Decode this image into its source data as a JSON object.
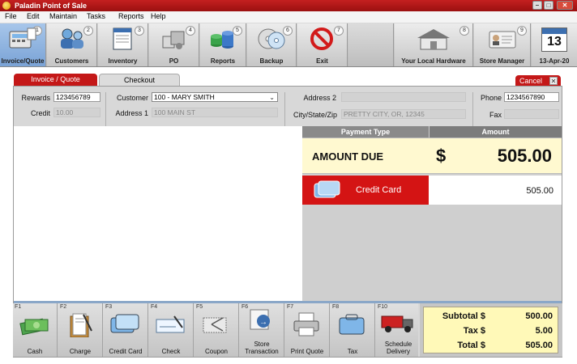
{
  "app": {
    "title": "Paladin Point of Sale"
  },
  "window": {
    "minimize": "–",
    "maximize": "□",
    "close": "✕"
  },
  "menu": [
    "File",
    "Edit",
    "Maintain",
    "Tasks",
    "Reports",
    "Help"
  ],
  "toolbar": {
    "items": [
      {
        "label": "Invoice/Quote",
        "key": "1",
        "icon": "invoice-icon"
      },
      {
        "label": "Customers",
        "key": "2",
        "icon": "customers-icon"
      },
      {
        "label": "Inventory",
        "key": "3",
        "icon": "inventory-icon"
      },
      {
        "label": "PO",
        "key": "4",
        "icon": "po-icon"
      },
      {
        "label": "Reports",
        "key": "5",
        "icon": "reports-icon"
      },
      {
        "label": "Backup",
        "key": "6",
        "icon": "backup-icon"
      },
      {
        "label": "Exit",
        "key": "7",
        "icon": "exit-icon"
      }
    ],
    "right_items": [
      {
        "label": "Your Local Hardware",
        "key": "8",
        "icon": "store-icon"
      },
      {
        "label": "Store Manager",
        "key": "9",
        "icon": "manager-icon"
      }
    ],
    "calendar": {
      "day": "13",
      "date": "13-Apr-20"
    }
  },
  "tabs": {
    "invoice": "Invoice / Quote",
    "checkout": "Checkout"
  },
  "cancel": {
    "label": "Cancel",
    "x": "✕"
  },
  "customer_form": {
    "rewards_label": "Rewards",
    "rewards_value": "123456789",
    "credit_label": "Credit",
    "credit_value": "10.00",
    "customer_label": "Customer",
    "customer_value": "100 - MARY SMITH",
    "address1_label": "Address 1",
    "address1_value": "100 MAIN ST",
    "address2_label": "Address 2",
    "address2_value": "",
    "cityzip_label": "City/State/Zip",
    "cityzip_value": "PRETTY CITY, OR, 12345",
    "phone_label": "Phone",
    "phone_value": "1234567890",
    "fax_label": "Fax",
    "fax_value": ""
  },
  "payment": {
    "type_header": "Payment Type",
    "amount_header": "Amount",
    "amount_due_label": "AMOUNT DUE",
    "currency": "$",
    "amount_due_value": "505.00",
    "method_label": "Credit Card",
    "method_value": "505.00"
  },
  "functions": [
    {
      "key": "F1",
      "label": "Cash"
    },
    {
      "key": "F2",
      "label": "Charge"
    },
    {
      "key": "F3",
      "label": "Credit Card"
    },
    {
      "key": "F4",
      "label": "Check"
    },
    {
      "key": "F5",
      "label": "Coupon"
    },
    {
      "key": "F6",
      "label": "Store Transaction"
    },
    {
      "key": "F7",
      "label": "Print Quote"
    },
    {
      "key": "F8",
      "label": "Tax"
    },
    {
      "key": "F10",
      "label": "Schedule Delivery"
    }
  ],
  "totals": {
    "subtotal_label": "Subtotal $",
    "subtotal_value": "500.00",
    "tax_label": "Tax $",
    "tax_value": "5.00",
    "total_label": "Total $",
    "total_value": "505.00"
  },
  "colors": {
    "brand_red": "#c41818",
    "amount_due_bg": "#fff9d0",
    "totals_bg": "#fff9b8",
    "active_tool": "#7aa3d6"
  }
}
